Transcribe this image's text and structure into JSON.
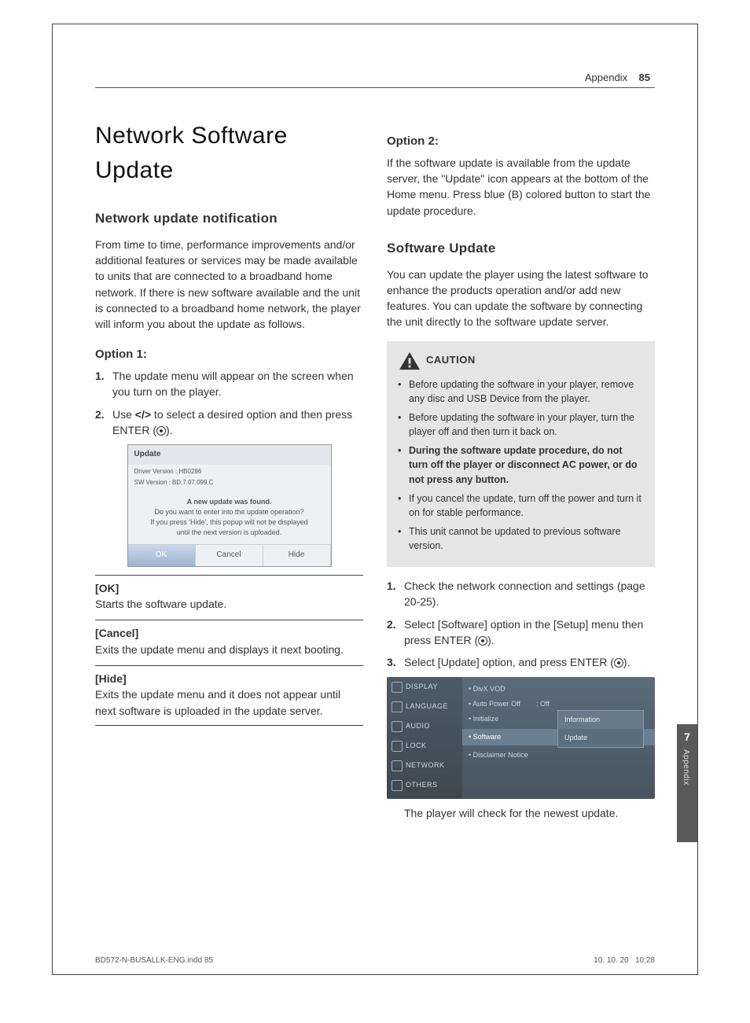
{
  "header": {
    "section": "Appendix",
    "page": "85"
  },
  "h1": "Network Software Update",
  "h2a": "Network update notification",
  "intro": "From time to time, performance improvements and/or additional features or services may be made available to units that are connected to a broadband home network. If there is new software available and the unit is connected to a broadband home network, the player will inform you about the update as follows.",
  "opt1": "Option 1:",
  "step1": "The update menu will appear on the screen when you turn on the player.",
  "step2a": "Use ",
  "step2b": " to select a desired option and then press ENTER (",
  "step2c": ").",
  "arrows": "</>",
  "dlg": {
    "title": "Update",
    "line1": "Driver Version : HB0286",
    "line2": "SW Version : BD.7.07.099.C",
    "msg1": "A new update was found.",
    "msg2": "Do you want to enter into the update operation?",
    "msg3": "If you press 'Hide', this popup will not be displayed",
    "msg4": "until the next version is uploaded.",
    "b1": "OK",
    "b2": "Cancel",
    "b3": "Hide"
  },
  "defs": [
    {
      "k": "[OK]",
      "v": "Starts the software update."
    },
    {
      "k": "[Cancel]",
      "v": "Exits the update menu and displays it next booting."
    },
    {
      "k": "[Hide]",
      "v": "Exits the update menu and it does not appear until next software is uploaded in the update server."
    }
  ],
  "opt2": "Option 2:",
  "opt2text": "If the software update is available from the update server, the \"Update\" icon appears at the bottom of the Home menu. Press blue (B) colored button to start the update procedure.",
  "h2b": "Software Update",
  "su_intro": "You can update the player using the latest software to enhance the products operation and/or add new features. You can update the software by connecting the unit directly to the software update server.",
  "caution_label": "CAUTION",
  "caution": [
    "Before updating the software in your player, remove any disc and USB Device from the player.",
    "Before updating the software in your player, turn the player off and then turn it back on.",
    "During the software update procedure, do not turn off the player or disconnect AC power, or do not press any button.",
    "If you cancel the update, turn off the power and turn it on for stable performance.",
    "This unit cannot be updated to previous software version."
  ],
  "su_steps": [
    "Check the network connection and settings (page 20-25).",
    "Select [Software] option in the [Setup] menu then press ENTER (",
    "Select [Update] option, and press ENTER ("
  ],
  "su_step_close": ").",
  "ss2": {
    "side": [
      "DISPLAY",
      "LANGUAGE",
      "AUDIO",
      "LOCK",
      "NETWORK",
      "OTHERS"
    ],
    "rows": [
      "• DivX VOD",
      "• Auto Power Off",
      "• Initialize",
      "• Software",
      "• Disclaimer Notice"
    ],
    "off": ": Off",
    "pop1": "Information",
    "pop2": "Update"
  },
  "su_after": "The player will check for the newest update.",
  "sidetab": {
    "num": "7",
    "label": "Appendix"
  },
  "footer": {
    "file": "BD572-N-BUSALLK-ENG.indd   85",
    "date": "10. 10. 20",
    "time": "10:28"
  }
}
